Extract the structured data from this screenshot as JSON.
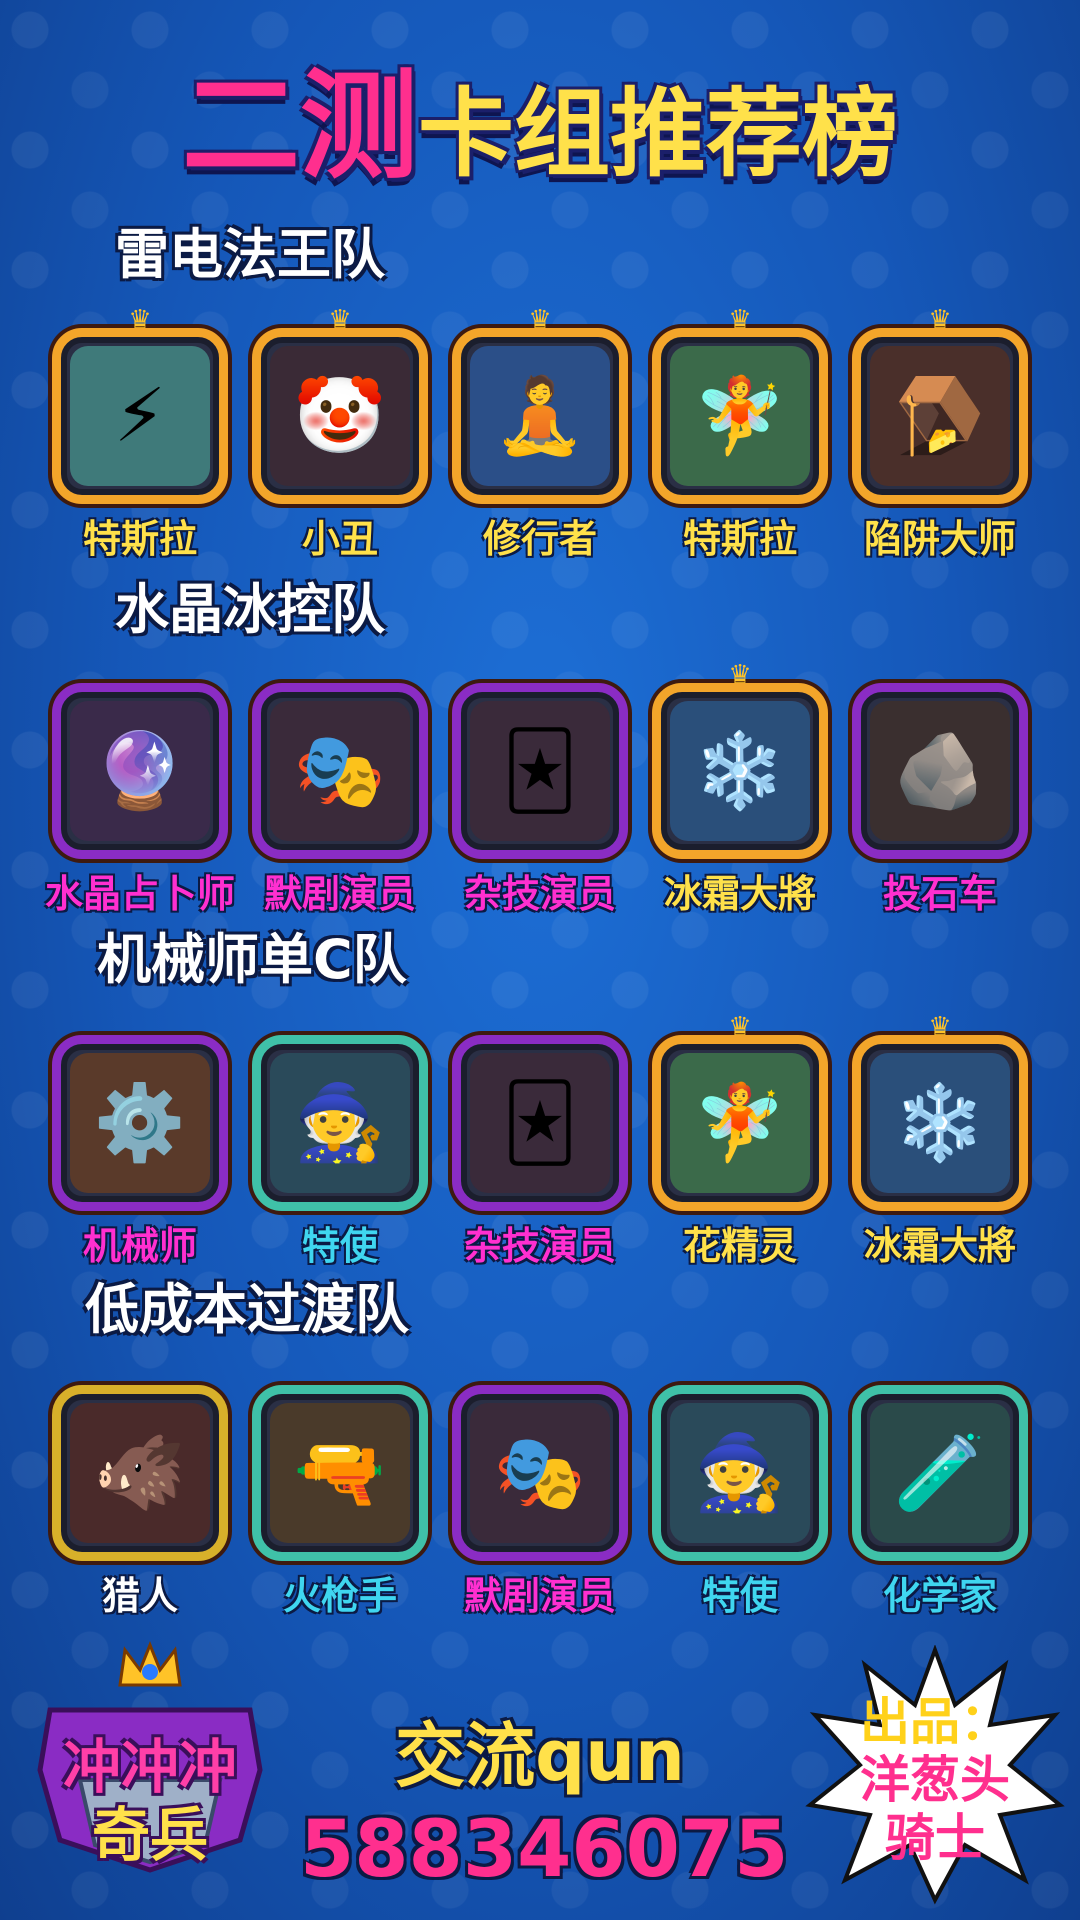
{
  "title": {
    "part1": "二测",
    "part2": "卡组推荐榜"
  },
  "colors": {
    "gold": "#f3a52a",
    "teal": "#3fc1a8",
    "purple": "#8a2cc4",
    "pink": "#ff2f8e",
    "yellow": "#ffe14a",
    "blue": "#1b74d8"
  },
  "sections": [
    {
      "title": "雷电法王队",
      "cards": [
        {
          "name": "特斯拉",
          "name_color": "#ffe14a",
          "frame": "gold",
          "inner": "#3f7a7a",
          "crown": true,
          "icon": "⚡"
        },
        {
          "name": "小丑",
          "name_color": "#ffe14a",
          "frame": "gold",
          "inner": "#3a2a36",
          "crown": true,
          "icon": "🤡"
        },
        {
          "name": "修行者",
          "name_color": "#ffe14a",
          "frame": "gold",
          "inner": "#2b4f88",
          "crown": true,
          "icon": "🧘"
        },
        {
          "name": "特斯拉",
          "name_color": "#ffe14a",
          "frame": "gold",
          "inner": "#3b6a4a",
          "crown": true,
          "icon": "🧚"
        },
        {
          "name": "陷阱大师",
          "name_color": "#ffe14a",
          "frame": "gold",
          "inner": "#4a2f2a",
          "crown": true,
          "icon": "🪤"
        }
      ]
    },
    {
      "title": "水晶冰控队",
      "cards": [
        {
          "name": "水晶占卜师",
          "name_color": "#ff2fd0",
          "frame": "purple",
          "inner": "#3a2a4a",
          "crown": false,
          "icon": "🔮"
        },
        {
          "name": "默剧演员",
          "name_color": "#ff2fd0",
          "frame": "purple",
          "inner": "#3a2a3a",
          "crown": false,
          "icon": "🎭"
        },
        {
          "name": "杂技演员",
          "name_color": "#ff2fd0",
          "frame": "purple",
          "inner": "#3a2a3a",
          "crown": false,
          "icon": "🃏"
        },
        {
          "name": "冰霜大將",
          "name_color": "#ffe14a",
          "frame": "gold",
          "inner": "#2a4f7a",
          "crown": true,
          "icon": "❄️"
        },
        {
          "name": "投石车",
          "name_color": "#ff2fd0",
          "frame": "purple",
          "inner": "#3a2f2f",
          "crown": false,
          "icon": "🪨"
        }
      ]
    },
    {
      "title": "机械师单C队",
      "cards": [
        {
          "name": "机械师",
          "name_color": "#ff2fd0",
          "frame": "purple",
          "inner": "#5a3a2a",
          "crown": false,
          "icon": "⚙️"
        },
        {
          "name": "特使",
          "name_color": "#3fd6f0",
          "frame": "teal",
          "inner": "#2a4a5a",
          "crown": false,
          "icon": "🧙"
        },
        {
          "name": "杂技演员",
          "name_color": "#ff2fd0",
          "frame": "purple",
          "inner": "#3a2a3a",
          "crown": false,
          "icon": "🃏"
        },
        {
          "name": "花精灵",
          "name_color": "#ffe14a",
          "frame": "gold",
          "inner": "#3b6a4a",
          "crown": true,
          "icon": "🧚"
        },
        {
          "name": "冰霜大將",
          "name_color": "#ffe14a",
          "frame": "gold",
          "inner": "#2a4f7a",
          "crown": true,
          "icon": "❄️"
        }
      ]
    },
    {
      "title": "低成本过渡队",
      "cards": [
        {
          "name": "猎人",
          "name_color": "#ffffff",
          "frame": "yellowdark",
          "inner": "#4a2a2a",
          "crown": false,
          "icon": "🐗"
        },
        {
          "name": "火枪手",
          "name_color": "#3fd6f0",
          "frame": "teal",
          "inner": "#4a3a2a",
          "crown": false,
          "icon": "🔫"
        },
        {
          "name": "默剧演员",
          "name_color": "#ff2fd0",
          "frame": "purple",
          "inner": "#3a2a3a",
          "crown": false,
          "icon": "🎭"
        },
        {
          "name": "特使",
          "name_color": "#3fd6f0",
          "frame": "teal",
          "inner": "#2a4a5a",
          "crown": false,
          "icon": "🧙"
        },
        {
          "name": "化学家",
          "name_color": "#3fd6f0",
          "frame": "teal",
          "inner": "#2a4a4a",
          "crown": false,
          "icon": "🧪"
        }
      ]
    }
  ],
  "logo": {
    "line1": "冲冲冲",
    "line2": "奇兵"
  },
  "contact": {
    "label": "交流qun",
    "number": "588346075"
  },
  "producer": {
    "line1": "出品：",
    "line2": "洋葱头",
    "line3": "骑士"
  }
}
